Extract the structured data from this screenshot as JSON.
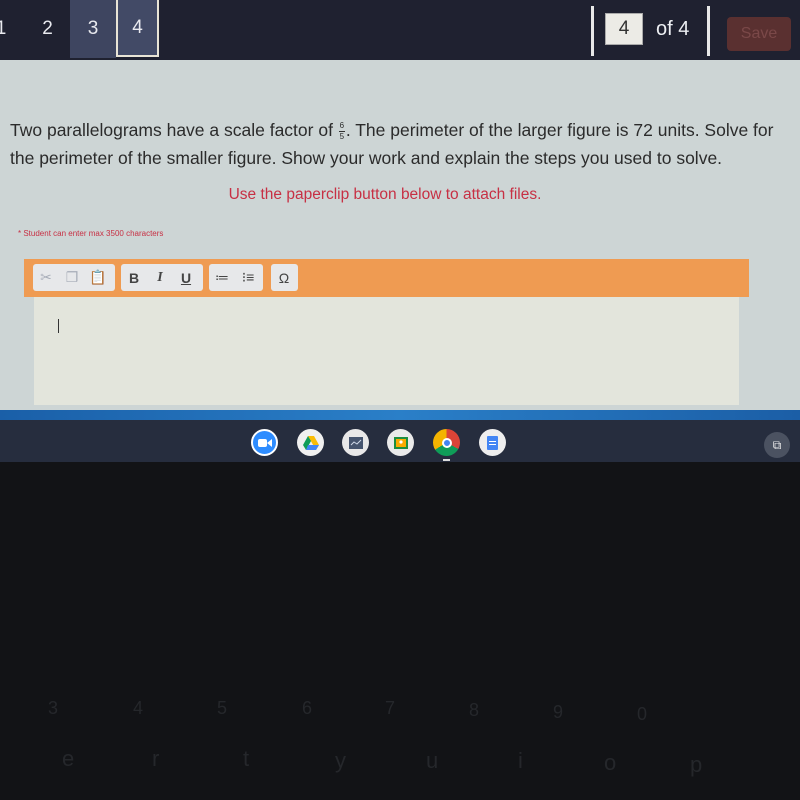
{
  "nav": {
    "question_tabs": [
      {
        "label": "1",
        "state": "default"
      },
      {
        "label": "2",
        "state": "default"
      },
      {
        "label": "3",
        "state": "visited"
      },
      {
        "label": "4",
        "state": "current"
      }
    ],
    "pager": {
      "current_page": "4",
      "of_label": "of 4"
    },
    "save_label": "Save"
  },
  "question": {
    "text_before": "Two parallelograms have a scale factor of ",
    "fraction": {
      "numerator": "6",
      "denominator": "5"
    },
    "text_after": ". The perimeter of the larger figure is 72 units. Solve for the perimeter of the smaller figure. Show your work and explain the steps you used to solve."
  },
  "instruction": "Use the paperclip button below to attach files.",
  "char_limit_note": "* Student can enter max 3500 characters",
  "editor": {
    "toolbar": {
      "clipboard": [
        {
          "icon": "cut-icon",
          "glyph": "✂",
          "enabled": false
        },
        {
          "icon": "copy-icon",
          "glyph": "❐",
          "enabled": false
        },
        {
          "icon": "paste-icon",
          "glyph": "📋",
          "enabled": true
        }
      ],
      "format": [
        {
          "icon": "bold-icon",
          "glyph": "B"
        },
        {
          "icon": "italic-icon",
          "glyph": "I"
        },
        {
          "icon": "underline-icon",
          "glyph": "U"
        }
      ],
      "lists": [
        {
          "icon": "numbered-list-icon",
          "glyph": "≔"
        },
        {
          "icon": "bulleted-list-icon",
          "glyph": "⁝≡"
        }
      ],
      "special": [
        {
          "icon": "special-character-icon",
          "glyph": "Ω"
        }
      ]
    },
    "value": ""
  },
  "shelf": {
    "apps": [
      {
        "name": "zoom"
      },
      {
        "name": "google-drive"
      },
      {
        "name": "app-3"
      },
      {
        "name": "google-classroom"
      },
      {
        "name": "chrome",
        "running": true
      },
      {
        "name": "google-docs"
      }
    ],
    "tray_glyph": "⧉"
  },
  "keyboard": {
    "number_row": [
      "3",
      "4",
      "5",
      "6",
      "7",
      "8",
      "9",
      "0"
    ],
    "letter_row": [
      "e",
      "r",
      "t",
      "y",
      "u",
      "i",
      "o",
      "p"
    ]
  }
}
